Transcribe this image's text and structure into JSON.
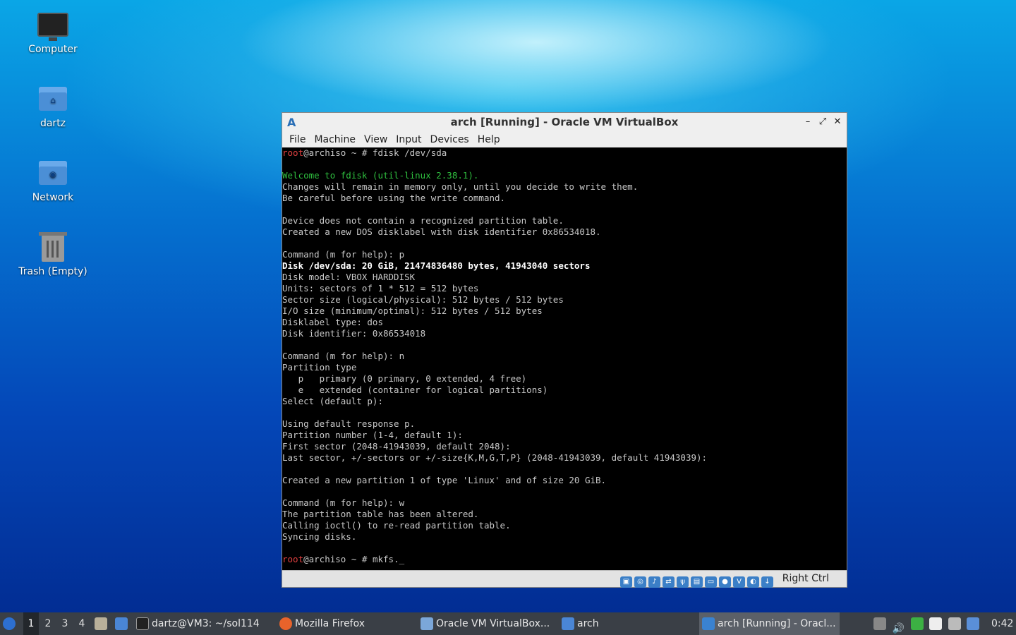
{
  "desktop": {
    "icons": [
      {
        "label": "Computer",
        "icon": "computer-icon"
      },
      {
        "label": "dartz",
        "icon": "home-folder-icon"
      },
      {
        "label": "Network",
        "icon": "network-folder-icon"
      },
      {
        "label": "Trash (Empty)",
        "icon": "trash-icon"
      }
    ]
  },
  "window": {
    "title": "arch [Running] - Oracle VM VirtualBox",
    "menu": [
      "File",
      "Machine",
      "View",
      "Input",
      "Devices",
      "Help"
    ],
    "host_key": "Right Ctrl"
  },
  "console": {
    "lines": [
      {
        "prompt_user": "root",
        "prompt_rest": "@archiso ~ # ",
        "cmd": "fdisk /dev/sda"
      },
      {
        "text": ""
      },
      {
        "text": "Welcome to fdisk (util-linux 2.38.1).",
        "style": "grn"
      },
      {
        "text": "Changes will remain in memory only, until you decide to write them."
      },
      {
        "text": "Be careful before using the write command."
      },
      {
        "text": ""
      },
      {
        "text": "Device does not contain a recognized partition table."
      },
      {
        "text": "Created a new DOS disklabel with disk identifier 0x86534018."
      },
      {
        "text": ""
      },
      {
        "text": "Command (m for help): p"
      },
      {
        "text": "Disk /dev/sda: 20 GiB, 21474836480 bytes, 41943040 sectors",
        "style": "wht"
      },
      {
        "text": "Disk model: VBOX HARDDISK"
      },
      {
        "text": "Units: sectors of 1 * 512 = 512 bytes"
      },
      {
        "text": "Sector size (logical/physical): 512 bytes / 512 bytes"
      },
      {
        "text": "I/O size (minimum/optimal): 512 bytes / 512 bytes"
      },
      {
        "text": "Disklabel type: dos"
      },
      {
        "text": "Disk identifier: 0x86534018"
      },
      {
        "text": ""
      },
      {
        "text": "Command (m for help): n"
      },
      {
        "text": "Partition type"
      },
      {
        "text": "   p   primary (0 primary, 0 extended, 4 free)"
      },
      {
        "text": "   e   extended (container for logical partitions)"
      },
      {
        "text": "Select (default p):"
      },
      {
        "text": ""
      },
      {
        "text": "Using default response p."
      },
      {
        "text": "Partition number (1-4, default 1):"
      },
      {
        "text": "First sector (2048-41943039, default 2048):"
      },
      {
        "text": "Last sector, +/-sectors or +/-size{K,M,G,T,P} (2048-41943039, default 41943039):"
      },
      {
        "text": ""
      },
      {
        "text": "Created a new partition 1 of type 'Linux' and of size 20 GiB."
      },
      {
        "text": ""
      },
      {
        "text": "Command (m for help): w"
      },
      {
        "text": "The partition table has been altered."
      },
      {
        "text": "Calling ioctl() to re-read partition table."
      },
      {
        "text": "Syncing disks."
      },
      {
        "text": ""
      },
      {
        "prompt_user": "root",
        "prompt_rest": "@archiso ~ # ",
        "cmd": "mkfs._"
      }
    ]
  },
  "taskbar": {
    "workspaces": [
      "1",
      "2",
      "3",
      "4"
    ],
    "active_workspace": "1",
    "tasks": [
      {
        "label": "dartz@VM3: ~/sol114",
        "icon": "terminal-icon"
      },
      {
        "label": "Mozilla Firefox",
        "icon": "firefox-icon"
      },
      {
        "label": "Oracle VM VirtualBox...",
        "icon": "virtualbox-icon"
      },
      {
        "label": "arch",
        "icon": "folder-icon"
      },
      {
        "label": "arch [Running] - Oracl...",
        "icon": "virtualbox-vm-icon"
      }
    ],
    "clock": "0:42"
  }
}
